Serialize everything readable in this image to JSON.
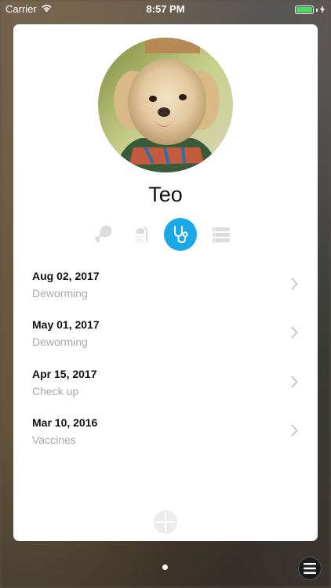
{
  "status_bar": {
    "carrier": "Carrier",
    "time": "8:57 PM",
    "battery_color": "#4cd964"
  },
  "profile": {
    "name": "Teo",
    "avatar_icon": "dog-photo"
  },
  "tabs": [
    {
      "name": "food",
      "icon": "drumstick-icon",
      "active": false
    },
    {
      "name": "grooming",
      "icon": "shower-icon",
      "active": false
    },
    {
      "name": "health",
      "icon": "stethoscope-icon",
      "active": true
    },
    {
      "name": "records",
      "icon": "list-icon",
      "active": false
    }
  ],
  "accent_color": "#1aa8e6",
  "records": [
    {
      "date": "Aug 02, 2017",
      "type": "Deworming"
    },
    {
      "date": "May 01, 2017",
      "type": "Deworming"
    },
    {
      "date": "Apr 15, 2017",
      "type": "Check up"
    },
    {
      "date": "Mar 10, 2016",
      "type": "Vaccines"
    }
  ]
}
